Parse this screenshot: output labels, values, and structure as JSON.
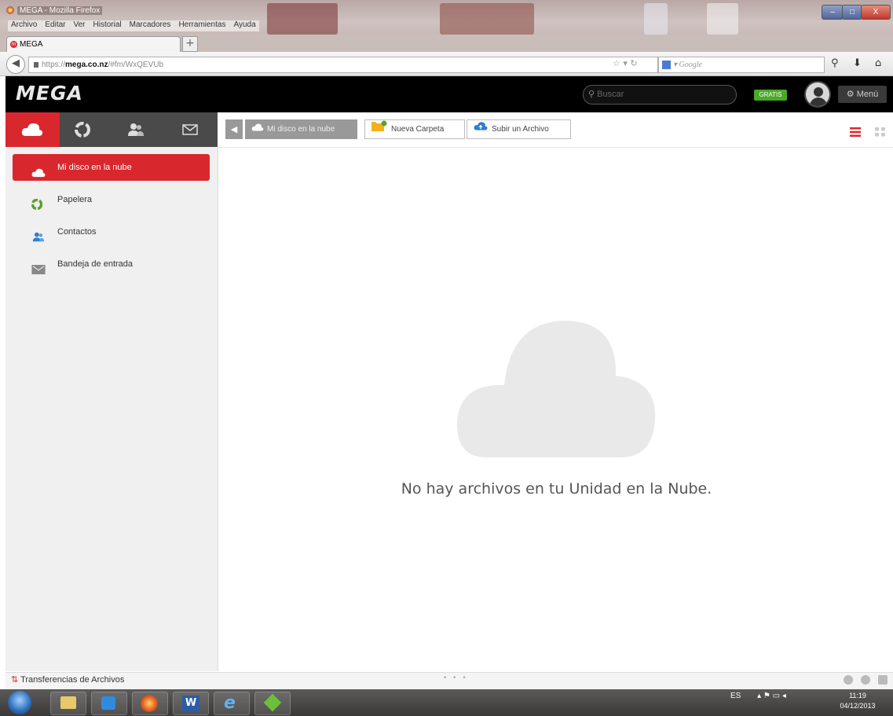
{
  "window": {
    "title": "MEGA - Mozilla Firefox",
    "menu": [
      "Archivo",
      "Editar",
      "Ver",
      "Historial",
      "Marcadores",
      "Herramientas",
      "Ayuda"
    ],
    "controls": {
      "minimize": "–",
      "maximize": "□",
      "close": "X"
    }
  },
  "browser": {
    "tab_title": "MEGA",
    "url_prefix": "https://",
    "url_host": "mega.co.nz",
    "url_path": "/#fm/WxQEVUb",
    "search_placeholder": "Google",
    "new_tab": "+"
  },
  "mega": {
    "logo": "MEGA",
    "search_placeholder": "Buscar",
    "plan_badge": "GRATIS",
    "menu_label": "Menú"
  },
  "sidebar": {
    "items": [
      {
        "label": "Mi disco en la nube"
      },
      {
        "label": "Papelera"
      },
      {
        "label": "Contactos"
      },
      {
        "label": "Bandeja de entrada"
      }
    ]
  },
  "toolbar": {
    "breadcrumb": "Mi disco en la nube",
    "new_folder": "Nueva Carpeta",
    "upload": "Subir un Archivo"
  },
  "main": {
    "empty_message": "No hay archivos en tu Unidad en la Nube."
  },
  "statusbar": {
    "transfers": "Transferencias de Archivos"
  },
  "taskbar": {
    "language": "ES",
    "time": "11:19",
    "date": "04/12/2013"
  },
  "colors": {
    "accent": "#d9272e",
    "header_bg": "#000000",
    "badge": "#4ca928"
  }
}
